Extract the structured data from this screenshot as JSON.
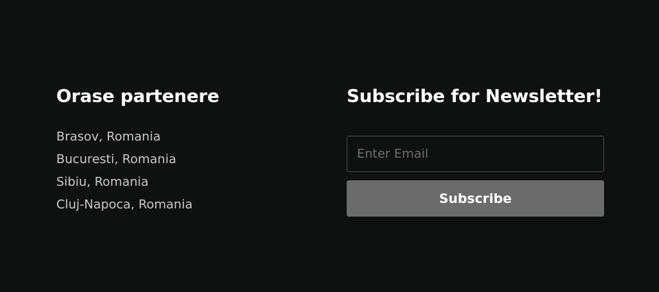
{
  "partners": {
    "title": "Orase partenere",
    "cities": [
      "Brasov, Romania",
      "Bucuresti, Romania",
      "Sibiu, Romania",
      "Cluj-Napoca, Romania"
    ]
  },
  "newsletter": {
    "title": "Subscribe for Newsletter!",
    "email_value": "",
    "email_placeholder": "Enter Email",
    "subscribe_label": "Subscribe"
  },
  "colors": {
    "background": "#0f1111",
    "heading_text": "#ffffff",
    "body_text": "#c9c9c9",
    "input_border": "#4a4d4d",
    "button_background": "#6b6b6b"
  }
}
